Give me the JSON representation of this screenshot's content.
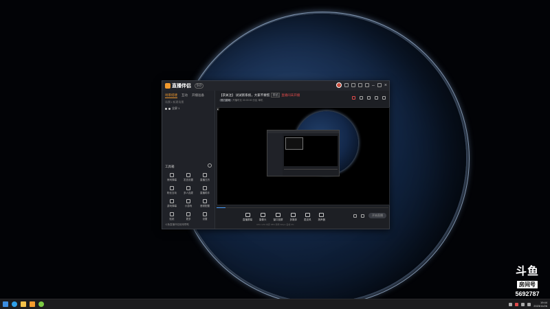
{
  "app": {
    "name": "直播伴侣",
    "version_badge": "9.0",
    "sidebar_tabs": [
      "场景搭建",
      "互动",
      "开播准备"
    ],
    "sidebar_line": "场景1  新建场景",
    "scene_label": "全屏 1",
    "tools_header": "工具箱",
    "tools": [
      {
        "label": "房间弹幕",
        "icon": "danmaku-icon"
      },
      {
        "label": "发言设置",
        "icon": "speech-icon"
      },
      {
        "label": "直播日历",
        "icon": "calendar-icon"
      },
      {
        "label": "粉丝互动",
        "icon": "fans-icon"
      },
      {
        "label": "多人连麦",
        "icon": "multi-mic-icon"
      },
      {
        "label": "直播助手",
        "icon": "assistant-icon"
      },
      {
        "label": "游戏弹幕",
        "icon": "game-danmaku-icon"
      },
      {
        "label": "小游戏",
        "icon": "minigame-icon"
      },
      {
        "label": "音频配置",
        "icon": "audio-config-icon"
      },
      {
        "label": "贴纸",
        "icon": "sticker-icon"
      },
      {
        "label": "更多",
        "icon": "more-icon"
      },
      {
        "label": "设置",
        "icon": "settings-icon"
      }
    ],
    "sidebar_footer": "斗鱼直播伴侣使用帮助",
    "room_title": "【求关注】 试试新系统，大家不要慌",
    "room_category": "单机",
    "room_warning": "直播间未开播",
    "room_sub_tag": "热门游戏",
    "room_sub_text": "开播时长 00:00:00   分区 单机",
    "controls": [
      {
        "label": "直播屏幕",
        "icon": "screen-icon"
      },
      {
        "label": "摄像头",
        "icon": "camera-icon"
      },
      {
        "label": "窗口投屏",
        "icon": "window-icon"
      },
      {
        "label": "多媒体",
        "icon": "media-icon"
      },
      {
        "label": "麦克风",
        "icon": "mic-icon"
      },
      {
        "label": "扬声器",
        "icon": "speaker-icon"
      }
    ],
    "start_button": "开始直播",
    "status_row": "CPU 12%   内存 38%   码率 0kbps   丢帧 0%",
    "progress_fraction": 0.05
  },
  "watermark": {
    "logo": "斗鱼",
    "room_label": "房间号",
    "room_number": "5692787"
  },
  "taskbar": {
    "time": "19:44",
    "date": "2023/11/26"
  },
  "colors": {
    "accent": "#f29a2e",
    "warning": "#e04b4b",
    "progress": "#4aa0ff"
  }
}
